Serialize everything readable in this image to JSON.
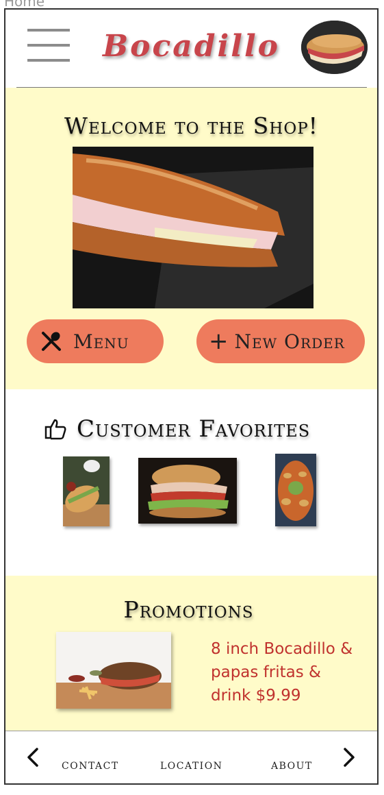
{
  "page": {
    "label": "Home"
  },
  "header": {
    "brand": "Bocadillo",
    "menu_icon": "hamburger-menu-icon",
    "avatar_icon": "sandwich-avatar"
  },
  "welcome": {
    "title": "Welcome to the Shop!",
    "buttons": {
      "menu_label": "Menu",
      "menu_icon": "utensils-icon",
      "new_order_label": "New Order",
      "new_order_icon": "plus-icon"
    }
  },
  "favorites": {
    "title": "Customer Favorites",
    "icon": "thumbs-up-icon"
  },
  "promotions": {
    "title": "Promotions",
    "text": "8 inch Bocadillo &\npapas fritas &\ndrink  $9.99"
  },
  "bottom_nav": {
    "links": [
      "contact",
      "location",
      "about"
    ],
    "prev_icon": "chevron-left-icon",
    "next_icon": "chevron-right-icon"
  },
  "colors": {
    "brand": "#c8454b",
    "accent_button": "#ee7b5d",
    "section_bg": "#fffbc9",
    "promo_text": "#c0322e"
  }
}
